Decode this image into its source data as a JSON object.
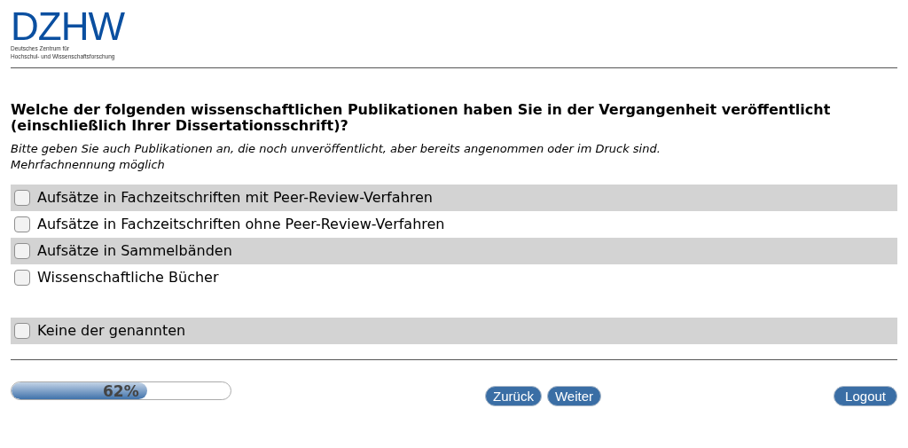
{
  "logo": {
    "wordmark": "DZHW",
    "subtitle_lines": [
      "Deutsches Zentrum für",
      "Hochschul- und Wissenschaftsforschung"
    ]
  },
  "question": {
    "title": "Welche der folgenden wissenschaftlichen Publikationen haben Sie in der Vergangenheit veröffentlicht (einschließlich Ihrer Dissertationsschrift)?",
    "instructions": [
      "Bitte geben Sie auch Publikationen an, die noch unveröffentlicht, aber bereits angenommen oder im Druck sind.",
      "Mehrfachnennung möglich"
    ]
  },
  "options": [
    {
      "label": "Aufsätze in Fachzeitschriften mit Peer-Review-Verfahren",
      "checked": false
    },
    {
      "label": "Aufsätze in Fachzeitschriften ohne Peer-Review-Verfahren",
      "checked": false
    },
    {
      "label": "Aufsätze in Sammelbänden",
      "checked": false
    },
    {
      "label": "Wissenschaftliche Bücher",
      "checked": false
    }
  ],
  "exclusive_option": {
    "label": "Keine der genannten",
    "checked": false
  },
  "progress": {
    "level": 0.62,
    "reading": "62%"
  },
  "buttons": {
    "back": "Zurück",
    "next": "Weiter",
    "logout": "Logout"
  }
}
